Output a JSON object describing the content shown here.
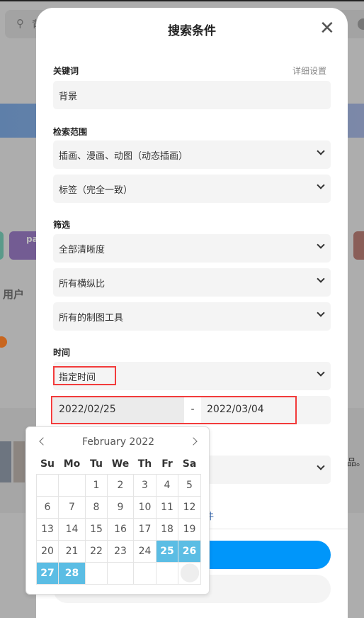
{
  "background": {
    "search_value": "背",
    "tail_text": "品。",
    "section": "用户",
    "tag_text": "pa"
  },
  "modal": {
    "title": "搜索条件",
    "keyword": {
      "label": "关键词",
      "advanced_link": "详细设置",
      "value": "背景"
    },
    "scope": {
      "label": "检索范围",
      "type_value": "插画、漫画、动图（动态插画）",
      "match_value": "标签（完全一致）"
    },
    "filter": {
      "label": "筛选",
      "resolution": "全部清晰度",
      "aspect": "所有横纵比",
      "tool": "所有的制图工具"
    },
    "time": {
      "label": "时间",
      "mode": "指定时间",
      "start": "2022/02/25",
      "separator": "-",
      "end": "2022/03/04"
    },
    "link_fragment": "件"
  },
  "calendar": {
    "month": "February 2022",
    "weekdays": [
      "Su",
      "Mo",
      "Tu",
      "We",
      "Th",
      "Fr",
      "Sa"
    ],
    "weeks": [
      [
        "",
        "",
        "1",
        "2",
        "3",
        "4",
        "5"
      ],
      [
        "6",
        "7",
        "8",
        "9",
        "10",
        "11",
        "12"
      ],
      [
        "13",
        "14",
        "15",
        "16",
        "17",
        "18",
        "19"
      ],
      [
        "20",
        "21",
        "22",
        "23",
        "24",
        "25",
        "26"
      ],
      [
        "27",
        "28",
        "",
        "",
        "",
        "",
        ""
      ]
    ],
    "selected": [
      "25",
      "26",
      "27",
      "28"
    ],
    "selected_color": "#5bbde4"
  }
}
